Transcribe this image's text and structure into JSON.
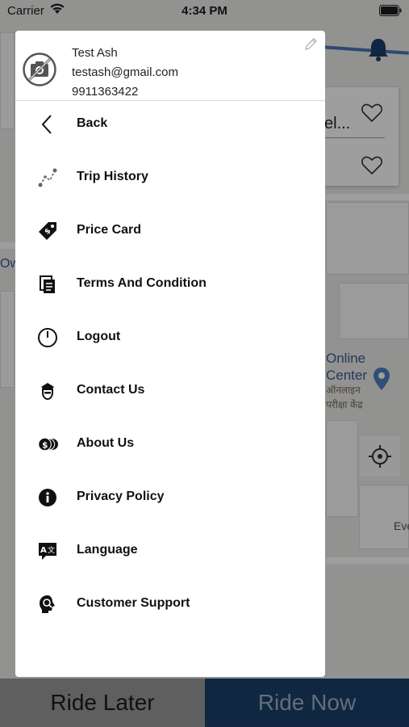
{
  "status_bar": {
    "carrier": "Carrier",
    "time": "4:34 PM"
  },
  "map": {
    "poi_name": "Online\nCenter",
    "poi_name_hindi": "ऑनलाइन\nपरीक्षा केंद्र",
    "favorite_text": "el...",
    "edge_text_1": "Ow",
    "edge_text_2": "Eve"
  },
  "profile": {
    "name": "Test Ash",
    "email": "testash@gmail.com",
    "phone": "9911363422"
  },
  "menu": {
    "items": [
      {
        "label": "Back",
        "icon": "back-arrow-icon"
      },
      {
        "label": "Trip History",
        "icon": "route-icon"
      },
      {
        "label": "Price Card",
        "icon": "price-tag-icon"
      },
      {
        "label": "Terms And Condition",
        "icon": "documents-icon"
      },
      {
        "label": "Logout",
        "icon": "power-icon"
      },
      {
        "label": "Contact Us",
        "icon": "driver-icon"
      },
      {
        "label": "About Us",
        "icon": "coins-icon"
      },
      {
        "label": "Privacy Policy",
        "icon": "info-icon"
      },
      {
        "label": "Language",
        "icon": "translate-icon"
      },
      {
        "label": "Customer Support",
        "icon": "support-icon"
      }
    ]
  },
  "bottom": {
    "ride_later": "Ride Later",
    "ride_now": "Ride Now"
  },
  "colors": {
    "ride_now_bg": "#1b3f6a",
    "ride_later_bg": "#9a9a9a",
    "route_line": "#4a76b8"
  }
}
